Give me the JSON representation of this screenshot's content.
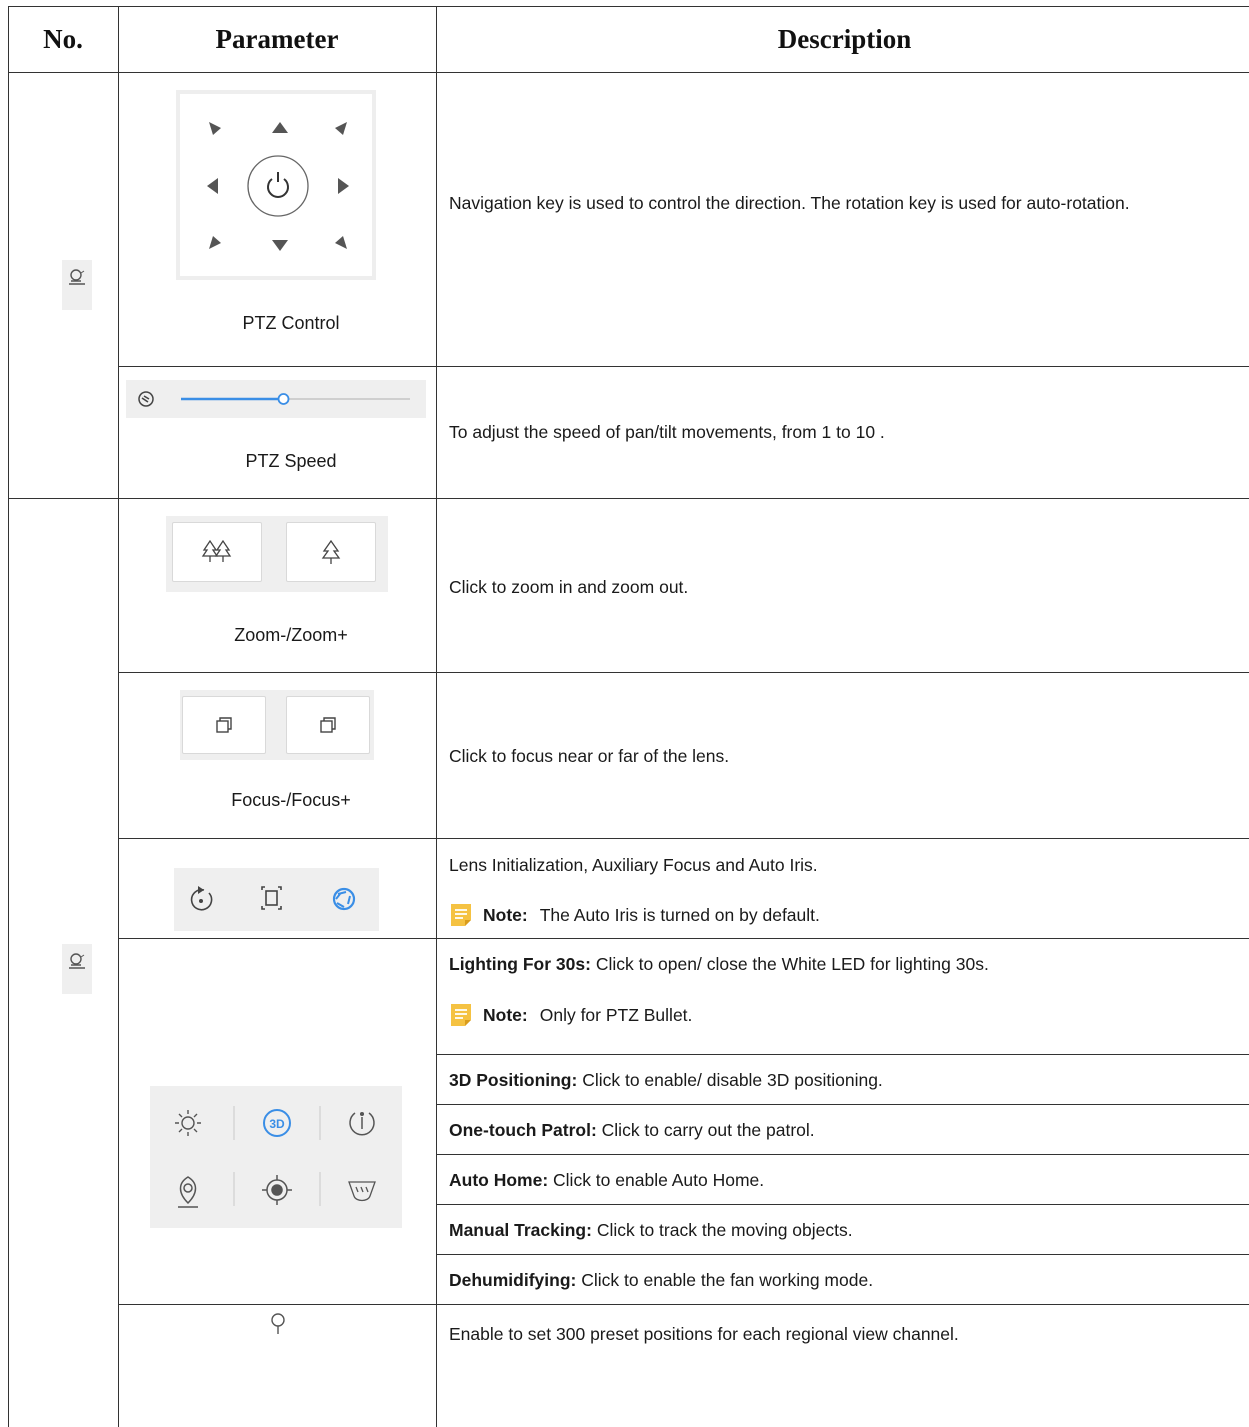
{
  "table": {
    "headers": {
      "no": "No.",
      "parameter": "Parameter",
      "description": "Description"
    },
    "rows": {
      "ptz_control": {
        "caption": "PTZ Control",
        "icon": "ptz-camera-icon",
        "description": "Navigation key is used to control the direction. The rotation key is used for auto-rotation."
      },
      "ptz_speed": {
        "caption": "PTZ Speed",
        "icon": "speed-icon",
        "slider_level_percent": 50,
        "description": "To adjust the speed of pan/tilt movements, from 1 to 10 ."
      },
      "zoom": {
        "caption": "Zoom-/Zoom+",
        "icons": [
          "zoom-out-trees-icon",
          "zoom-in-tree-icon"
        ],
        "description": "Click to zoom in and zoom out."
      },
      "focus": {
        "caption": "Focus-/Focus+",
        "icons": [
          "focus-near-icon",
          "focus-far-icon"
        ],
        "description": "Click to focus near or far of the lens."
      },
      "lens": {
        "icons": [
          "lens-init-icon",
          "aux-focus-icon",
          "auto-iris-icon"
        ],
        "description": "Lens Initialization, Auxiliary Focus and Auto Iris.",
        "note_label": "Note:",
        "note_text": "The Auto Iris is turned on by default."
      },
      "functions": {
        "icons": [
          "light-icon",
          "3d-positioning-icon",
          "one-touch-patrol-icon",
          "auto-home-icon",
          "manual-tracking-icon",
          "dehumidify-icon"
        ],
        "icon_3d_text": "3D",
        "lighting_label": "Lighting For 30s:",
        "lighting_text": "Click to open/ close the White LED for lighting 30s.",
        "lighting_note_label": "Note:",
        "lighting_note_text": "Only for PTZ Bullet.",
        "items": [
          {
            "label": "3D Positioning:",
            "text": "Click to enable/ disable 3D positioning."
          },
          {
            "label": "One-touch Patrol:",
            "text": "Click to carry out the patrol."
          },
          {
            "label": "Auto Home:",
            "text": "Click to enable Auto Home."
          },
          {
            "label": "Manual Tracking:",
            "text": "Click to track the moving objects."
          },
          {
            "label": "Dehumidifying:",
            "text": "Click to enable the fan working mode."
          }
        ]
      },
      "preset": {
        "icon": "preset-pin-icon",
        "description": "Enable to set 300 preset positions for each regional view channel."
      }
    }
  },
  "colors": {
    "border": "#333333",
    "panel_bg": "#efefef",
    "accent_blue": "#3a8ee6",
    "note_yellow": "#f5c242"
  }
}
